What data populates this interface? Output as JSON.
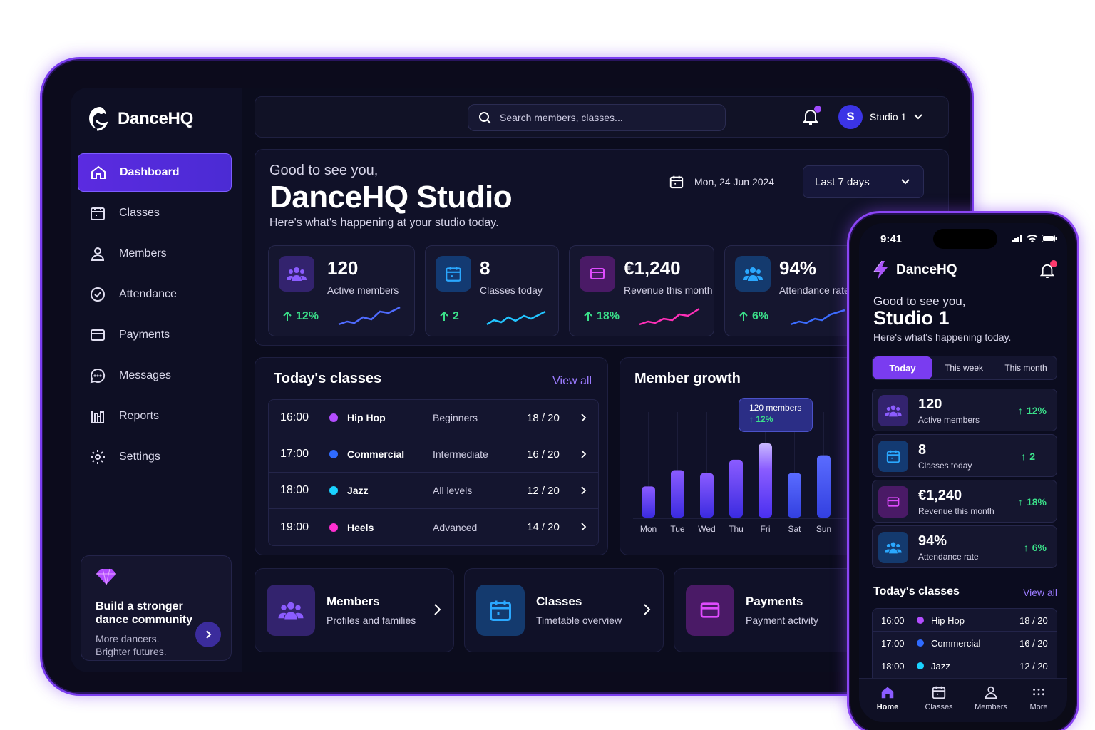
{
  "brand": {
    "name": "DanceHQ"
  },
  "sidebar": {
    "items": [
      {
        "label": "Dashboard",
        "icon": "home-icon",
        "active": true
      },
      {
        "label": "Classes",
        "icon": "calendar-icon"
      },
      {
        "label": "Members",
        "icon": "user-icon"
      },
      {
        "label": "Attendance",
        "icon": "check-circle-icon"
      },
      {
        "label": "Payments",
        "icon": "card-icon"
      },
      {
        "label": "Messages",
        "icon": "chat-icon"
      },
      {
        "label": "Reports",
        "icon": "reports-icon"
      },
      {
        "label": "Settings",
        "icon": "gear-icon"
      }
    ],
    "promo": {
      "title": "Build a stronger dance community",
      "subtitle": "More dancers. Brighter futures.",
      "icon": "diamond-icon"
    }
  },
  "topbar": {
    "search_placeholder": "Search members, classes...",
    "user_initial": "S",
    "user_name": "Studio 1"
  },
  "hero": {
    "greeting": "Good to see you,",
    "title": "DanceHQ Studio",
    "subtitle": "Here's what's happening at your studio today.",
    "date": "Mon, 24 Jun 2024",
    "range": "Last 7 days"
  },
  "stats": [
    {
      "value": "120",
      "label": "Active members",
      "delta": "12%",
      "color": "#7c4dff",
      "spark": "#4f6bff"
    },
    {
      "value": "8",
      "label": "Classes today",
      "delta": "2",
      "color": "#2f8cff",
      "spark": "#22c4ff"
    },
    {
      "value": "€1,240",
      "label": "Revenue this month",
      "delta": "18%",
      "color": "#d43cff",
      "spark": "#ff2fb8"
    },
    {
      "value": "94%",
      "label": "Attendance rate",
      "delta": "6%",
      "color": "#2aa8ff",
      "spark": "#3b6cff"
    }
  ],
  "classes": {
    "title": "Today's classes",
    "view_all": "View all",
    "rows": [
      {
        "time": "16:00",
        "name": "Hip Hop",
        "level": "Beginners",
        "capacity": "18 / 20",
        "color": "#b34dff"
      },
      {
        "time": "17:00",
        "name": "Commercial",
        "level": "Intermediate",
        "capacity": "16 / 20",
        "color": "#2f6bff"
      },
      {
        "time": "18:00",
        "name": "Jazz",
        "level": "All levels",
        "capacity": "12 / 20",
        "color": "#1ad2ff"
      },
      {
        "time": "19:00",
        "name": "Heels",
        "level": "Advanced",
        "capacity": "14 / 20",
        "color": "#ff2fd0"
      }
    ]
  },
  "growth": {
    "title": "Member growth",
    "tooltip_value": "120 members",
    "tooltip_delta": "12%"
  },
  "chart_data": {
    "type": "bar",
    "categories": [
      "Mon",
      "Tue",
      "Wed",
      "Thu",
      "Fri",
      "Sat",
      "Sun"
    ],
    "values": [
      42,
      64,
      60,
      78,
      100,
      60,
      84
    ],
    "ylim": [
      0,
      100
    ],
    "highlight": "Fri"
  },
  "quick": [
    {
      "title": "Members",
      "subtitle": "Profiles and families",
      "icon": "members-icon",
      "color": "#7c4dff"
    },
    {
      "title": "Classes",
      "subtitle": "Timetable overview",
      "icon": "calendar-icon",
      "color": "#2aa8ff"
    },
    {
      "title": "Payments",
      "subtitle": "Payment activity",
      "icon": "card-icon",
      "color": "#d43cff"
    }
  ],
  "phone": {
    "time": "9:41",
    "greeting": "Good to see you,",
    "title": "Studio 1",
    "subtitle": "Here's what's happening today.",
    "tabs": [
      "Today",
      "This week",
      "This month"
    ],
    "stats": [
      {
        "value": "120",
        "label": "Active members",
        "delta": "12%"
      },
      {
        "value": "8",
        "label": "Classes today",
        "delta": "2"
      },
      {
        "value": "€1,240",
        "label": "Revenue this month",
        "delta": "18%"
      },
      {
        "value": "94%",
        "label": "Attendance rate",
        "delta": "6%"
      }
    ],
    "classes_title": "Today's classes",
    "view_all": "View all",
    "rows": [
      {
        "time": "16:00",
        "name": "Hip Hop",
        "capacity": "18 / 20"
      },
      {
        "time": "17:00",
        "name": "Commercial",
        "capacity": "16 / 20"
      },
      {
        "time": "18:00",
        "name": "Jazz",
        "capacity": "12 / 20"
      }
    ],
    "nav": [
      "Home",
      "Classes",
      "Members",
      "More"
    ]
  }
}
